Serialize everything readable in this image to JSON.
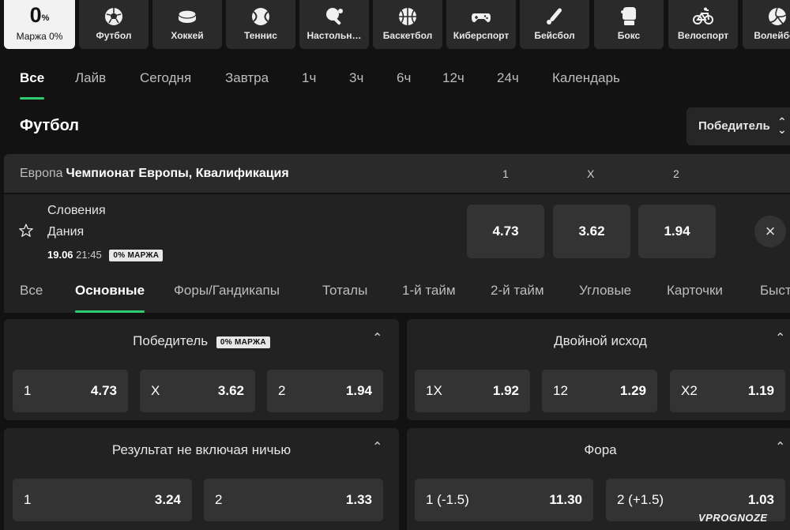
{
  "margin_tile": {
    "value": "0",
    "unit": "%",
    "caption": "Маржа 0%"
  },
  "sports": [
    {
      "label": "Футбол",
      "icon": "soccer-ball-icon"
    },
    {
      "label": "Хоккей",
      "icon": "hockey-puck-icon"
    },
    {
      "label": "Теннис",
      "icon": "tennis-ball-icon"
    },
    {
      "label": "Настольн…",
      "icon": "table-tennis-icon"
    },
    {
      "label": "Баскетбол",
      "icon": "basketball-icon"
    },
    {
      "label": "Киберспорт",
      "icon": "gamepad-icon"
    },
    {
      "label": "Бейсбол",
      "icon": "baseball-bat-icon"
    },
    {
      "label": "Бокс",
      "icon": "boxing-glove-icon"
    },
    {
      "label": "Велоспорт",
      "icon": "bicycle-icon"
    },
    {
      "label": "Волейбол",
      "icon": "volleyball-icon"
    }
  ],
  "time_filters": [
    "Все",
    "Лайв",
    "Сегодня",
    "Завтра",
    "1ч",
    "3ч",
    "6ч",
    "12ч",
    "24ч",
    "Календарь"
  ],
  "section": {
    "title": "Футбол",
    "sort_label": "Победитель"
  },
  "league": {
    "region": "Европа",
    "name": "Чемпионат Европы, Квалификация",
    "cols": [
      "1",
      "X",
      "2"
    ]
  },
  "match": {
    "home": "Словения",
    "away": "Дания",
    "date": "19.06",
    "time": "21:45",
    "badge": "0% МАРЖА",
    "odds": [
      "4.73",
      "3.62",
      "1.94"
    ],
    "close_glyph": "×"
  },
  "market_tabs": [
    "Все",
    "Основные",
    "Форы/Гандикапы",
    "Тоталы",
    "1-й тайм",
    "2-й тайм",
    "Угловые",
    "Карточки",
    "Быстрые"
  ],
  "markets": {
    "winner": {
      "title": "Победитель",
      "badge": "0% МАРЖА",
      "options": [
        {
          "k": "1",
          "v": "4.73"
        },
        {
          "k": "X",
          "v": "3.62"
        },
        {
          "k": "2",
          "v": "1.94"
        }
      ]
    },
    "double": {
      "title": "Двойной исход",
      "options": [
        {
          "k": "1X",
          "v": "1.92"
        },
        {
          "k": "12",
          "v": "1.29"
        },
        {
          "k": "X2",
          "v": "1.19"
        }
      ]
    },
    "dnb": {
      "title": "Результат не включая ничью",
      "options": [
        {
          "k": "1",
          "v": "3.24"
        },
        {
          "k": "2",
          "v": "1.33"
        }
      ]
    },
    "handicap": {
      "title": "Фора",
      "options": [
        {
          "k": "1 (-1.5)",
          "v": "11.30"
        },
        {
          "k": "2 (+1.5)",
          "v": "1.03"
        }
      ]
    }
  },
  "watermark": "VPROGNOZE",
  "colors": {
    "accent": "#2ecc71",
    "background": "#121212",
    "panel": "#222222",
    "button": "#333333"
  }
}
